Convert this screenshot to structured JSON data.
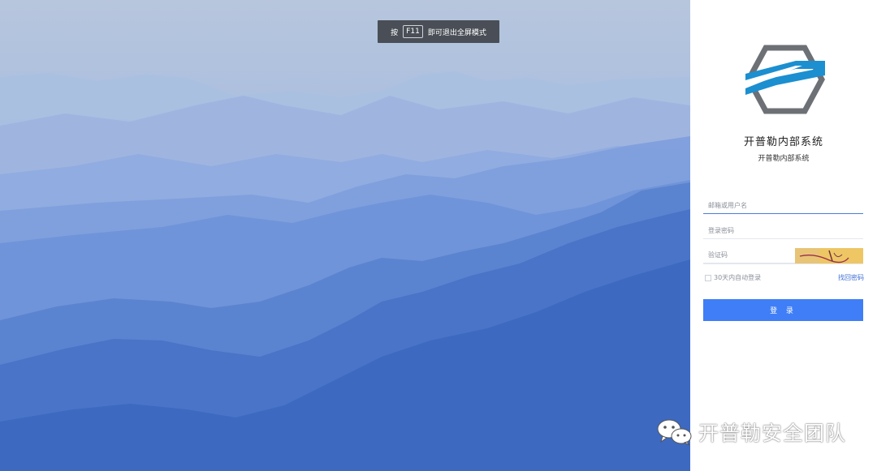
{
  "fullscreen_notice": {
    "prefix": "按",
    "key": "F11",
    "suffix": "即可退出全屏模式"
  },
  "login_panel": {
    "title": "开普勒内部系统",
    "subtitle": "开普勒内部系统",
    "username_placeholder": "邮箱或用户名",
    "password_placeholder": "登录密码",
    "captcha_placeholder": "验证码",
    "remember_label": "30天内自动登录",
    "forgot_link": "找回密码",
    "login_button": "登 录"
  },
  "watermark": {
    "text": "开普勒安全团队"
  },
  "colors": {
    "accent": "#3f7ef6",
    "logo_blue": "#1b8fd0",
    "logo_gray": "#6d7075"
  }
}
